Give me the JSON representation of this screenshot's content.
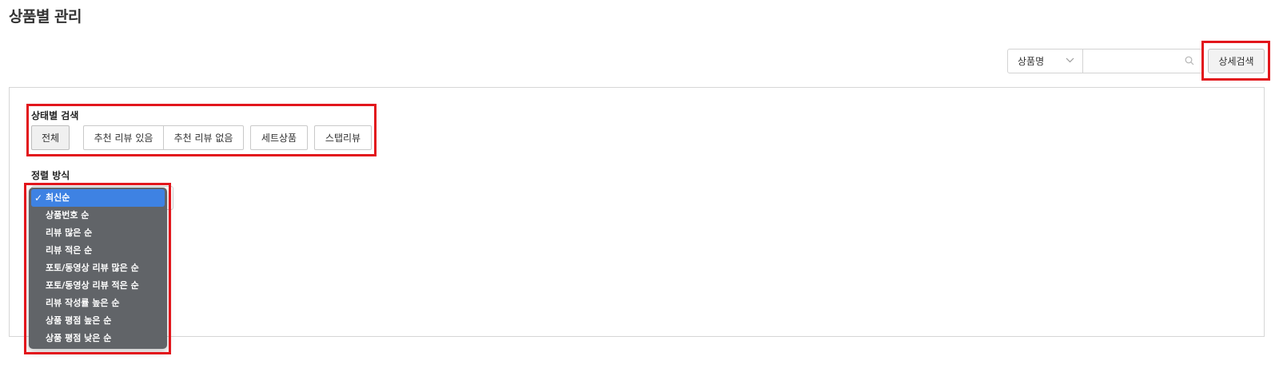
{
  "page": {
    "title": "상품별 관리"
  },
  "top_search": {
    "filter_selected": "상품명",
    "query_value": "",
    "detail_button": "상세검색"
  },
  "status_filter": {
    "label": "상태별 검색",
    "options": [
      "전체",
      "추천 리뷰 있음",
      "추천 리뷰 없음",
      "세트상품",
      "스탭리뷰"
    ],
    "active": "전체"
  },
  "sort": {
    "label": "정렬 방식",
    "options": [
      "최신순",
      "상품번호 순",
      "리뷰 많은 순",
      "리뷰 적은 순",
      "포토/동영상 리뷰 많은 순",
      "포토/동영상 리뷰 적은 순",
      "리뷰 작성률 높은 순",
      "상품 평점 높은 순",
      "상품 평점 낮은 순"
    ],
    "selected": "최신순"
  },
  "colors": {
    "highlight": "#e2161c",
    "dropdown_bg": "#616468",
    "dropdown_selected": "#3e82e3"
  },
  "icons": {
    "search": "search-icon",
    "chevron": "chevron-down-icon",
    "check": "check-icon"
  }
}
